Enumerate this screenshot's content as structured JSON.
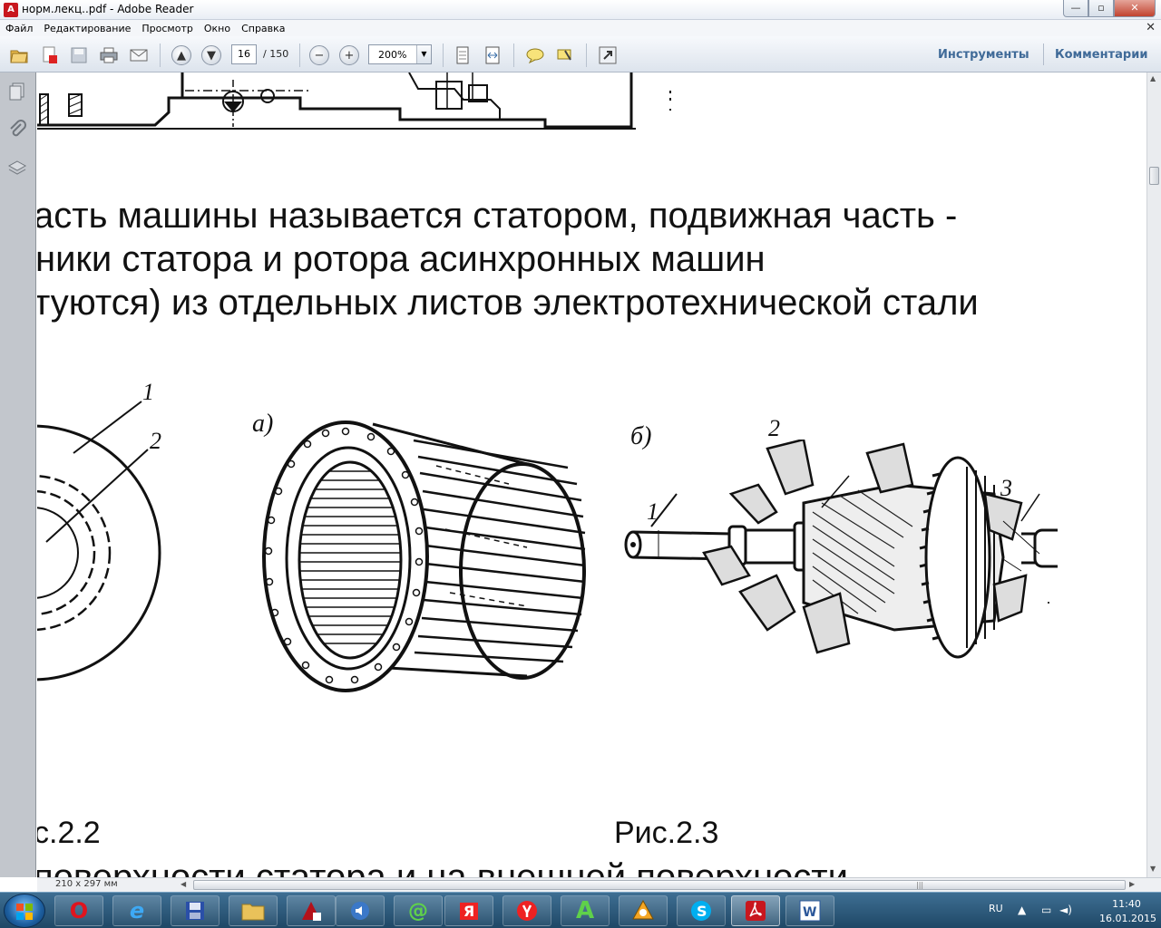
{
  "window": {
    "title": "норм.лекц..pdf - Adobe Reader",
    "buttons": {
      "minimize": "—",
      "maximize": "▫",
      "close": "✕"
    }
  },
  "menu": {
    "items": [
      "Файл",
      "Редактирование",
      "Просмотр",
      "Окно",
      "Справка"
    ],
    "close_glyph": "✕"
  },
  "toolbar": {
    "page_current": "16",
    "page_total": "/ 150",
    "zoom": "200%",
    "tools_label": "Инструменты",
    "comments_label": "Комментарии",
    "icons": [
      "open-icon",
      "create-pdf-icon",
      "save-icon",
      "print-icon",
      "email-icon",
      "page-up-icon",
      "page-down-icon",
      "zoom-out-icon",
      "zoom-in-icon",
      "fit-page-icon",
      "fit-width-icon",
      "comment-icon",
      "highlight-icon",
      "expand-icon"
    ]
  },
  "nav_panel": {
    "icons": [
      "pages-icon",
      "attachments-icon",
      "layers-icon"
    ]
  },
  "document": {
    "lines": [
      "асть машины называется статором, подвижная часть -",
      "ники  статора и ротора  асинхронных машин",
      "туются) из отдельных листов электротехнической стали"
    ],
    "figure_labels": {
      "fig22_1": "1",
      "fig22_2": "2",
      "fig23a": "а)",
      "fig23b": "б)",
      "rotor_1": "1",
      "rotor_2": "2",
      "rotor_3": "3"
    },
    "caption_left": "с.2.2",
    "caption_right": "Рис.2.3",
    "bottom_line": "поверхности статора и на внешней поверхности"
  },
  "statusbar": {
    "page_dims": "210 x 297 мм"
  },
  "taskbar": {
    "apps": [
      "opera",
      "internet-explorer",
      "save-disk",
      "explorer",
      "adobe-acrobat",
      "audio",
      "mail-ru",
      "yandex",
      "yandex-browser",
      "a-app",
      "avast",
      "skype",
      "adobe-reader",
      "word"
    ],
    "language": "RU",
    "time": "11:40",
    "date": "16.01.2015"
  },
  "colors": {
    "accent_link": "#3f6a98",
    "taskbar": "#1f4866"
  }
}
